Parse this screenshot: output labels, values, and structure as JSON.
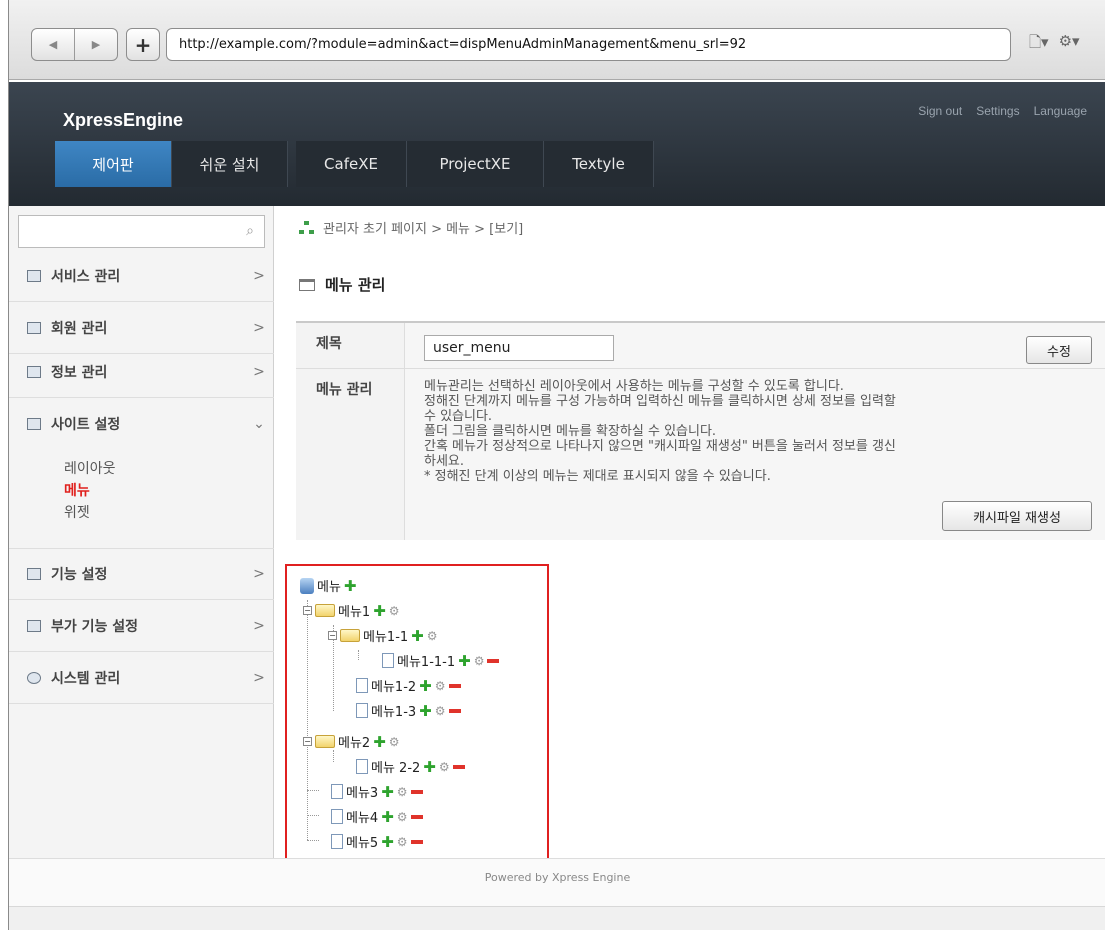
{
  "browser": {
    "back_label": "◀",
    "forward_label": "▶",
    "new_tab_label": "+",
    "url": "http://example.com/?module=admin&act=dispMenuAdminManagement&menu_srl=92",
    "page_menu": "🗋▾",
    "tools_menu": "⚙▾"
  },
  "header": {
    "brand": "XpressEngine",
    "links": [
      "Sign out",
      "Settings",
      "Language"
    ],
    "tabs": [
      "제어판",
      "쉬운 설치",
      "CafeXE",
      "ProjectXE",
      "Textyle"
    ]
  },
  "sidebar": {
    "items": [
      {
        "label": "서비스 관리",
        "arrow": ">"
      },
      {
        "label": "회원 관리",
        "arrow": ">"
      },
      {
        "label": "정보 관리",
        "arrow": ">"
      },
      {
        "label": "사이트 설정",
        "arrow": "⌄"
      },
      {
        "label": "기능 설정",
        "arrow": ">"
      },
      {
        "label": "부가 기능 설정",
        "arrow": ">"
      },
      {
        "label": "시스템 관리",
        "arrow": ">"
      }
    ],
    "subitems": [
      "레이아웃",
      "메뉴",
      "위젯"
    ]
  },
  "breadcrumb": "관리자 초기 페이지 > 메뉴 > [보기]",
  "page_title": "메뉴 관리",
  "form": {
    "title_label": "제목",
    "title_value": "user_menu",
    "edit_button": "수정",
    "manage_label": "메뉴 관리",
    "desc_lines": [
      "메뉴관리는 선택하신 레이아웃에서 사용하는 메뉴를 구성할 수 있도록 합니다.",
      "정해진 단계까지 메뉴를 구성 가능하며 입력하신 메뉴를 클릭하시면 상세 정보를 입력할",
      "수 있습니다.",
      "폴더 그림을 클릭하시면 메뉴를 확장하실 수 있습니다.",
      "간혹 메뉴가 정상적으로 나타나지 않으면 \"캐시파일 재생성\" 버튼을 눌러서 정보를 갱신",
      "하세요.",
      "* 정해진 단계 이상의 메뉴는 제대로 표시되지 않을 수 있습니다."
    ],
    "cache_button": "캐시파일 재생성"
  },
  "tree": {
    "root": "메뉴",
    "nodes": [
      "메뉴1",
      "메뉴1-1",
      "메뉴1-1-1",
      "메뉴1-2",
      "메뉴1-3",
      "메뉴2",
      "메뉴 2-2",
      "메뉴3",
      "메뉴4",
      "메뉴5"
    ]
  },
  "footer": "Powered by Xpress Engine"
}
